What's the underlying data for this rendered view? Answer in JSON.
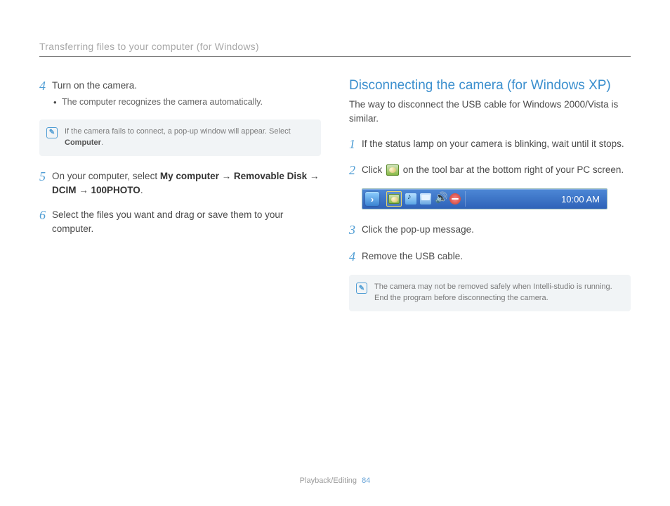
{
  "header": "Transferring files to your computer (for Windows)",
  "left": {
    "step4": {
      "num": "4",
      "text": "Turn on the camera.",
      "bullet": "The computer recognizes the camera automatically."
    },
    "note1": {
      "text_before": "If the camera fails to connect, a pop-up window will appear. Select ",
      "bold": "Computer",
      "text_after": "."
    },
    "step5": {
      "num": "5",
      "lead": "On your computer, select ",
      "p1": "My computer",
      "arr1": " → ",
      "p2": "Removable Disk",
      "arr2": " → ",
      "p3": "DCIM",
      "arr3": " → ",
      "p4": "100PHOTO",
      "tail": "."
    },
    "step6": {
      "num": "6",
      "text": "Select the files you want and drag or save them to your computer."
    }
  },
  "right": {
    "title": "Disconnecting the camera (for Windows XP)",
    "subtitle": "The way to disconnect the USB cable for Windows 2000/Vista is similar.",
    "step1": {
      "num": "1",
      "text": "If the status lamp on your camera is blinking, wait until it stops."
    },
    "step2": {
      "num": "2",
      "before": "Click ",
      "after": " on the tool bar at the bottom right of your PC screen."
    },
    "taskbar": {
      "time": "10:00 AM"
    },
    "step3": {
      "num": "3",
      "text": "Click the pop-up message."
    },
    "step4": {
      "num": "4",
      "text": "Remove the USB cable."
    },
    "note2": "The camera may not be removed safely when Intelli-studio is running. End the program before disconnecting the camera."
  },
  "footer": {
    "section": "Playback/Editing",
    "page": "84"
  }
}
